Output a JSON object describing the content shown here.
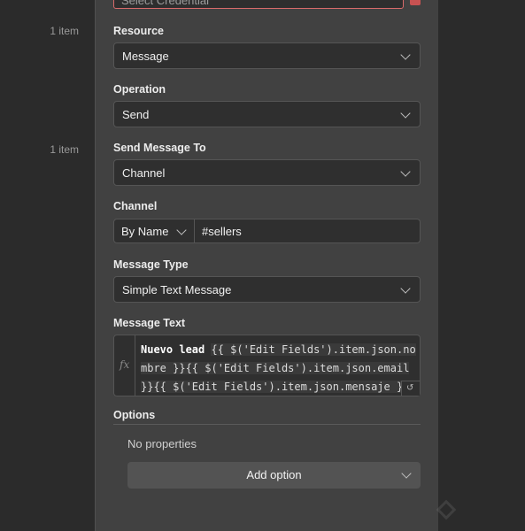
{
  "item_counts": [
    "1 item",
    "1 item"
  ],
  "credential": {
    "value": "Select Credential"
  },
  "resource": {
    "label": "Resource",
    "value": "Message"
  },
  "operation": {
    "label": "Operation",
    "value": "Send"
  },
  "send_to": {
    "label": "Send Message To",
    "value": "Channel"
  },
  "channel": {
    "label": "Channel",
    "mode": "By Name",
    "value": "#sellers"
  },
  "message_type": {
    "label": "Message Type",
    "value": "Simple Text Message"
  },
  "message_text": {
    "label": "Message Text",
    "line1_plain": "Nuevo lead ",
    "line1_expr": "{{ $('Edit Fields').item.json.no",
    "line2_expr": "mbre }}{{ $('Edit Fields').item.json.email",
    "line3_expr": "}}{{ $('Edit Fields').item.json.mensaje }",
    "fx_icon": "fx-icon",
    "expand_icon": "expand-icon"
  },
  "options": {
    "label": "Options",
    "empty_text": "No properties",
    "add_button_label": "Add option"
  },
  "colors": {
    "panel_bg": "#414141",
    "page_bg": "#2b2b2b",
    "input_bg": "#2f2f2f",
    "error_border": "#d76a6a",
    "button_bg": "#535353"
  }
}
